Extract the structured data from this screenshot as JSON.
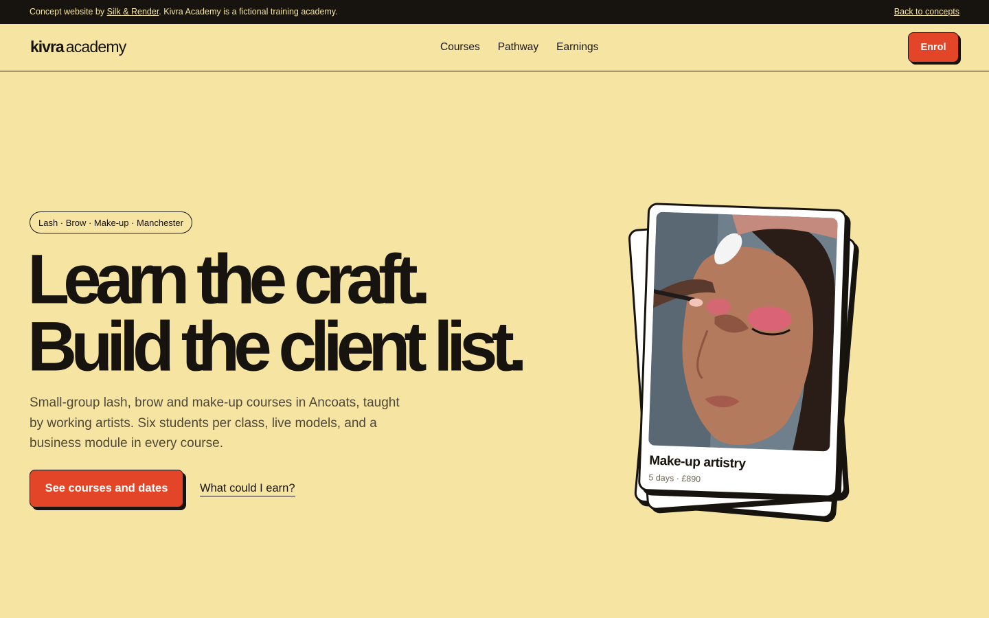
{
  "concept_bar": {
    "prefix": "Concept website by ",
    "studio_link": "Silk & Render",
    "suffix": ". Kivra Academy is a fictional training academy.",
    "back_link": "Back to concepts"
  },
  "header": {
    "logo_bold": "kivra",
    "logo_light": "academy",
    "nav": [
      "Courses",
      "Pathway",
      "Earnings"
    ],
    "enrol_label": "Enrol"
  },
  "hero": {
    "tagline": "Lash · Brow · Make-up · Manchester",
    "headline_line1": "Learn the craft.",
    "headline_line2": "Build the client list.",
    "intro": "Small-group lash, brow and make-up courses in Ancoats, taught by working artists. Six students per class, live models, and a business module in every course.",
    "cta_primary": "See courses and dates",
    "cta_secondary": "What could I earn?"
  },
  "course_card": {
    "title": "Make-up artistry",
    "meta": "5 days · £890"
  },
  "colors": {
    "background": "#f6e5a2",
    "ink": "#17130e",
    "accent": "#e24528"
  }
}
